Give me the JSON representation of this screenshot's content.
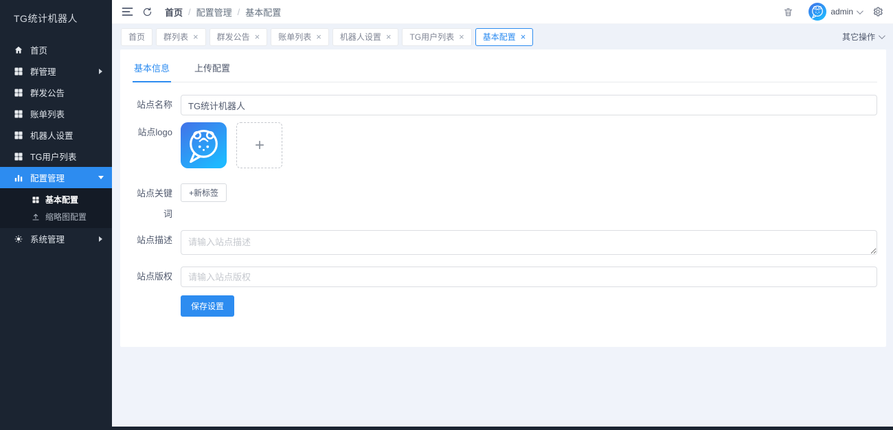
{
  "app": {
    "title": "TG统计机器人"
  },
  "colors": {
    "primary": "#2d8cf0",
    "sidebar_bg": "#1b2431",
    "submenu_bg": "#141b26",
    "page_bg": "#f0f3fa",
    "logo_gradient_start": "#4272e8",
    "logo_gradient_end": "#1eb8ff"
  },
  "sidebar": {
    "items": [
      {
        "label": "首页",
        "icon": "home-icon"
      },
      {
        "label": "群管理",
        "icon": "grid-icon",
        "arrow": "right"
      },
      {
        "label": "群发公告",
        "icon": "grid-icon"
      },
      {
        "label": "账单列表",
        "icon": "grid-icon"
      },
      {
        "label": "机器人设置",
        "icon": "grid-icon"
      },
      {
        "label": "TG用户列表",
        "icon": "grid-icon"
      },
      {
        "label": "配置管理",
        "icon": "bar-chart-icon",
        "arrow": "down",
        "active": true
      }
    ],
    "submenu": [
      {
        "label": "基本配置",
        "icon": "grid-icon",
        "active": true
      },
      {
        "label": "缩略图配置",
        "icon": "upload-icon"
      }
    ],
    "system_item": {
      "label": "系统管理",
      "icon": "gear-icon",
      "arrow": "right"
    }
  },
  "header": {
    "breadcrumb": {
      "0": "首页",
      "1": "配置管理",
      "2": "基本配置"
    },
    "separator": "/",
    "user": "admin"
  },
  "tabs": {
    "items": [
      {
        "label": "首页"
      },
      {
        "label": "群列表"
      },
      {
        "label": "群发公告"
      },
      {
        "label": "账单列表"
      },
      {
        "label": "机器人设置"
      },
      {
        "label": "TG用户列表"
      },
      {
        "label": "基本配置",
        "active": true
      }
    ],
    "close_glyph": "×",
    "more_label": "其它操作"
  },
  "content": {
    "tabs": [
      {
        "label": "基本信息",
        "active": true
      },
      {
        "label": "上传配置"
      }
    ],
    "form": {
      "site_name": {
        "label": "站点名称",
        "value": "TG统计机器人"
      },
      "site_logo": {
        "label": "站点logo",
        "upload_plus": "+"
      },
      "site_keywords": {
        "label": "站点关键词",
        "add_tag_label": "+新标签"
      },
      "site_description": {
        "label": "站点描述",
        "placeholder": "请输入站点描述"
      },
      "site_copyright": {
        "label": "站点版权",
        "placeholder": "请输入站点版权"
      },
      "save_label": "保存设置"
    }
  }
}
